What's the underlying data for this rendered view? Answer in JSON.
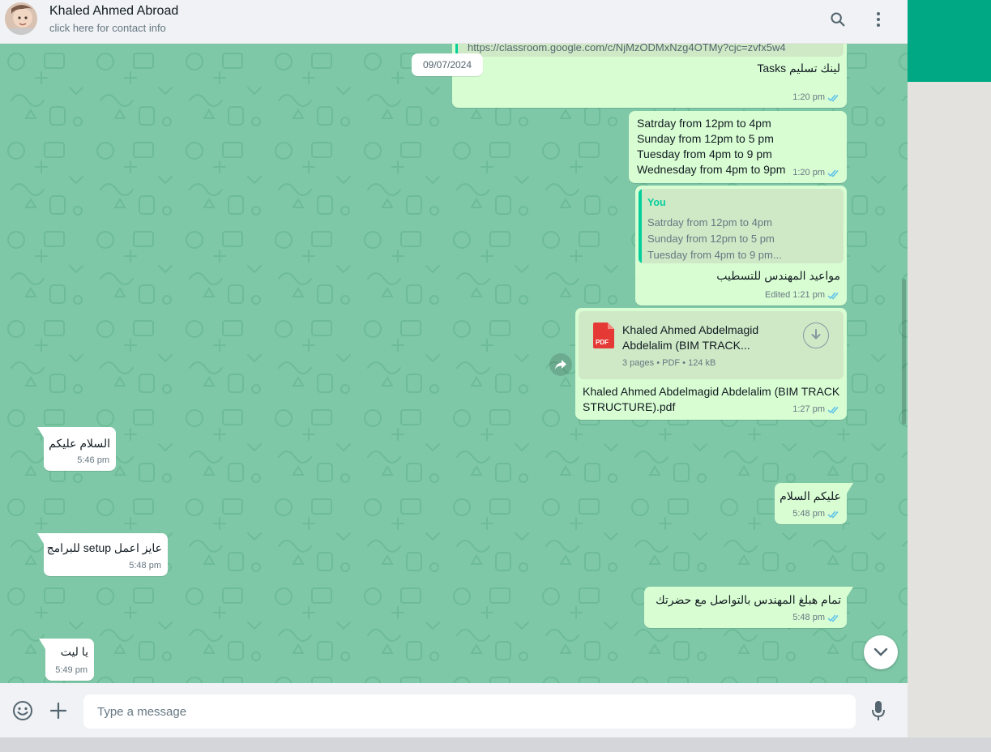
{
  "contact": {
    "name": "Khaled Ahmed Abroad",
    "subtitle": "click here for contact info"
  },
  "header_icons": [
    "search-icon",
    "menu-icon"
  ],
  "date_chip": "09/07/2024",
  "messages": {
    "link_msg": {
      "url": "https://classroom.google.com/c/NjMzODMxNzg4OTMy?cjc=zvfx5w4",
      "text": "لينك تسليم Tasks",
      "time": "1:20 pm"
    },
    "schedule_msg": {
      "lines": [
        "Satrday from 12pm to 4pm",
        "Sunday from 12pm to 5 pm",
        "Tuesday from 4pm to 9 pm",
        "Wednesday from 4pm to 9pm"
      ],
      "time": "1:20 pm"
    },
    "reply_msg": {
      "quote_author": "You",
      "quote_lines": [
        "Satrday from 12pm to 4pm",
        "Sunday from 12pm to 5 pm",
        "Tuesday from 4pm to 9 pm..."
      ],
      "text": "مواعيد المهندس للتسطيب",
      "edited_label": "Edited",
      "time": "1:21 pm"
    },
    "doc_msg": {
      "doc_title_1": "Khaled Ahmed Abdelmagid",
      "doc_title_2": "Abdelalim (BIM TRACK...",
      "doc_info": "3 pages • PDF • 124 kB",
      "pdf_label": "PDF",
      "caption_1": "Khaled Ahmed Abdelmagid Abdelalim (BIM TRACK",
      "caption_2": "STRUCTURE).pdf",
      "time": "1:27 pm"
    },
    "in_msg_1": {
      "text": "السلام عليكم",
      "time": "5:46 pm"
    },
    "out_msg_1": {
      "text": "عليكم السلام",
      "time": "5:48 pm"
    },
    "in_msg_2": {
      "text": "عايز اعمل setup للبرامج",
      "time": "5:48 pm"
    },
    "out_msg_2": {
      "text": "تمام هبلغ المهندس بالتواصل مع حضرتك",
      "time": "5:48 pm"
    },
    "in_msg_3": {
      "text": "يا ليت",
      "time": "5:49 pm"
    }
  },
  "composer": {
    "placeholder": "Type a message",
    "icons": [
      "emoji-icon",
      "plus-icon",
      "microphone-icon"
    ]
  },
  "colors": {
    "wallpaper": "#7ec8a7",
    "outgoing_bubble": "#d9fdd3",
    "incoming_bubble": "#ffffff",
    "accent": "#00a884",
    "read_ticks": "#53bdeb"
  }
}
